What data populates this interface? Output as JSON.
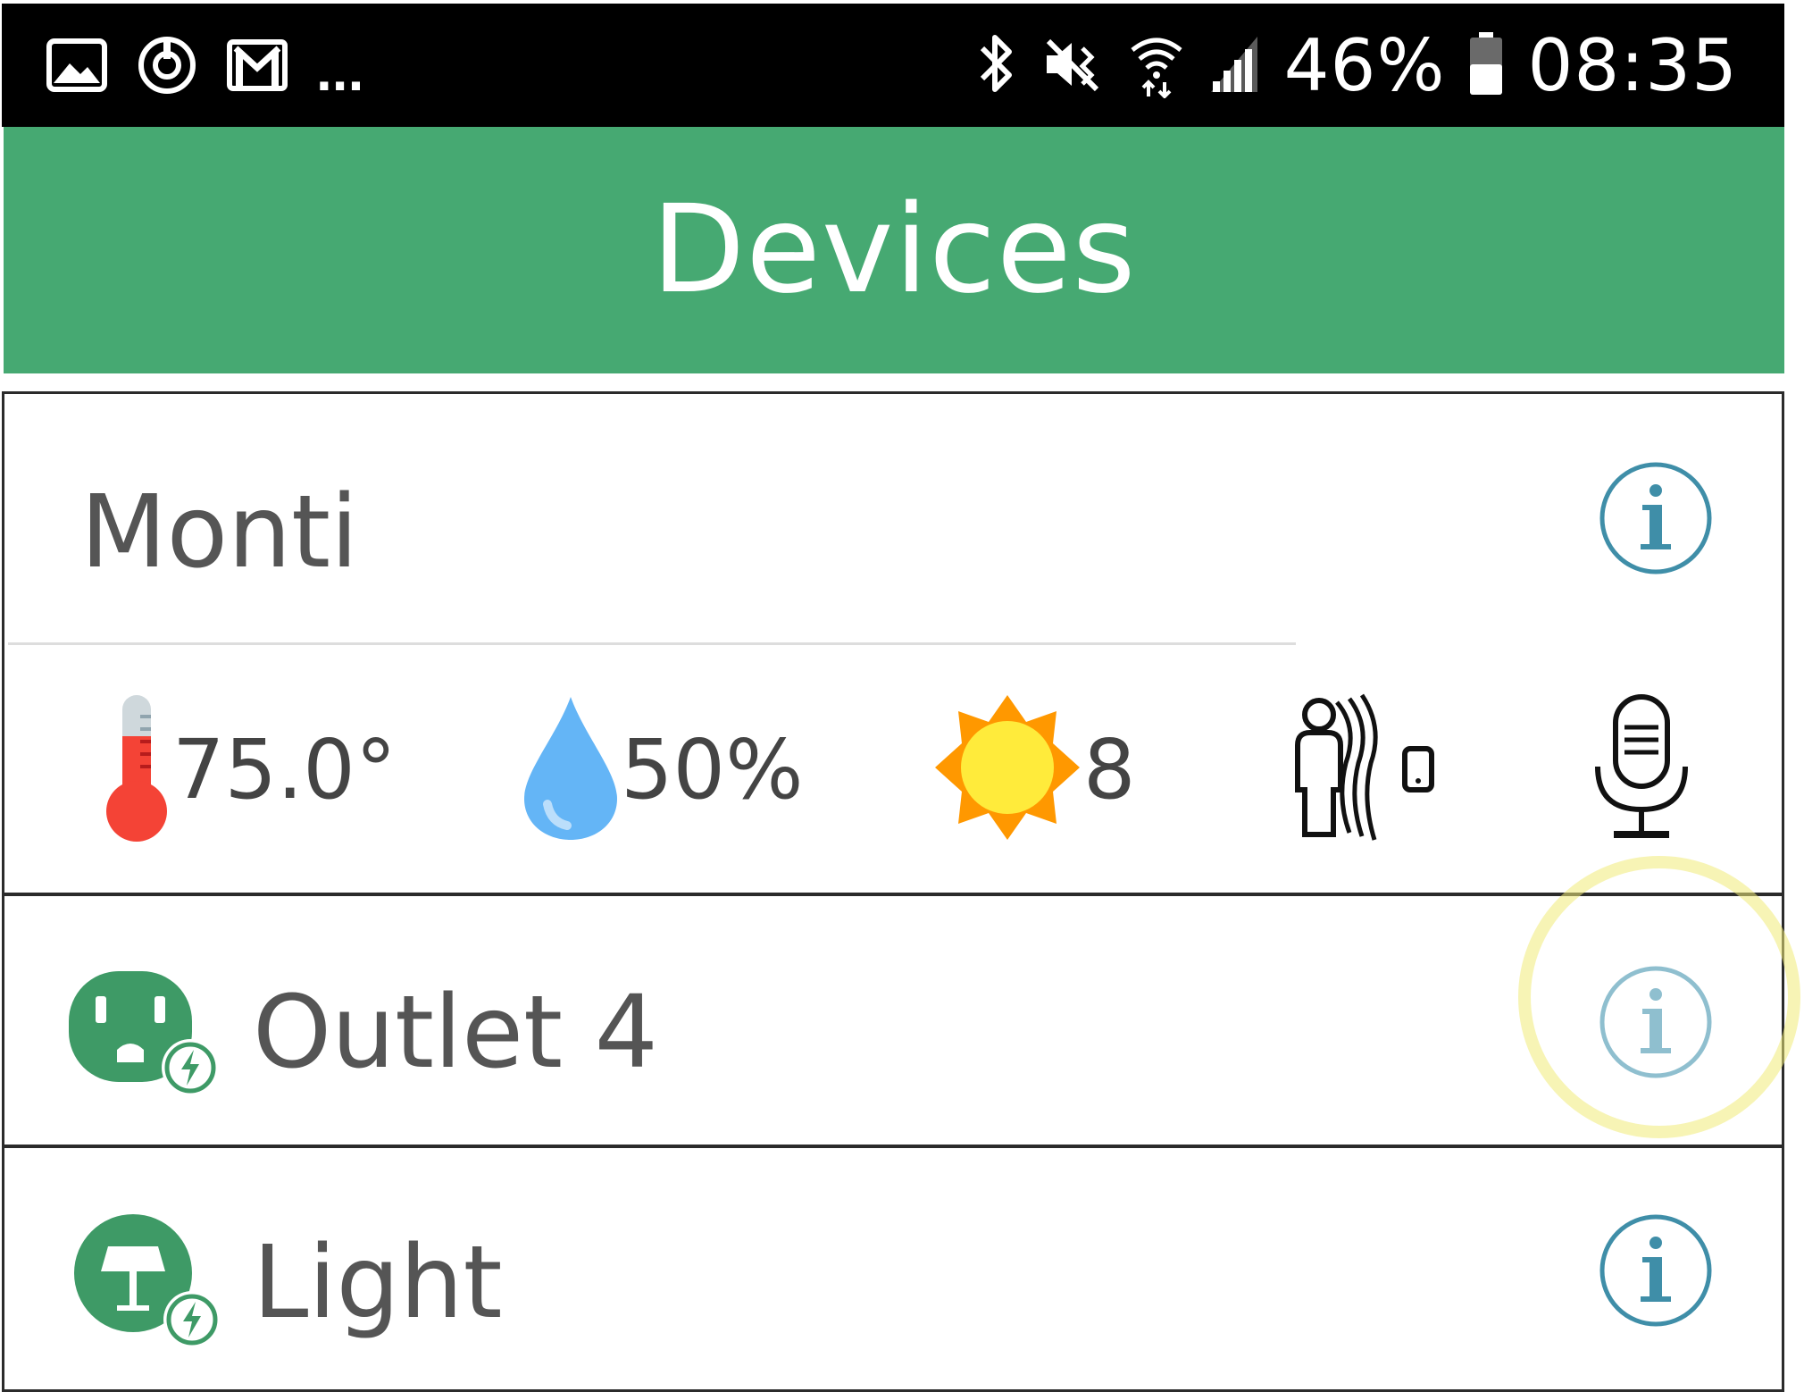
{
  "status_bar": {
    "left_icons": [
      "gallery-icon",
      "sync-icon",
      "gmail-icon"
    ],
    "overflow": "...",
    "right_icons": [
      "bluetooth-icon",
      "vibrate-mute-icon",
      "wifi-icon",
      "cell-signal-icon",
      "battery-icon"
    ],
    "battery_percent": "46%",
    "time": "08:35"
  },
  "app_bar": {
    "title": "Devices"
  },
  "devices": [
    {
      "name": "Monti",
      "icon": "info-icon",
      "sensors": {
        "temperature": {
          "icon": "thermometer-icon",
          "value": "75.0°"
        },
        "humidity": {
          "icon": "water-drop-icon",
          "value": "50%"
        },
        "light": {
          "icon": "sun-icon",
          "value": "8"
        },
        "motion": {
          "icon": "motion-sensor-icon"
        },
        "sound": {
          "icon": "microphone-icon"
        }
      }
    },
    {
      "name": "Outlet 4",
      "icon": "outlet-icon",
      "info_icon": "info-icon",
      "highlighted": true
    },
    {
      "name": "Light",
      "icon": "lamp-icon",
      "info_icon": "info-icon"
    }
  ],
  "colors": {
    "app_bar": "#46a972",
    "info_icon": "#3f8ea8",
    "device_icon": "#3e9a66",
    "text": "#555555",
    "highlight": "#f0eb78"
  }
}
